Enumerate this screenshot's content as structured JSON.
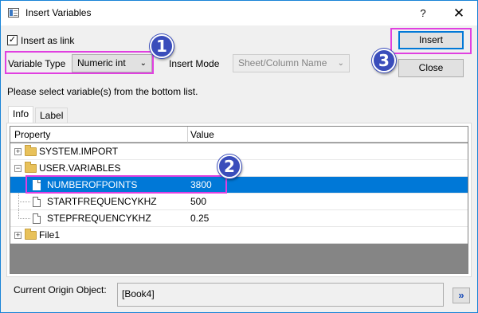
{
  "window": {
    "title": "Insert Variables",
    "help_glyph": "?",
    "close_glyph": "✕"
  },
  "options": {
    "insert_as_link_label": "Insert as link",
    "insert_as_link_checked": true,
    "check_glyph": "✓",
    "variable_type_label": "Variable Type",
    "variable_type_value": "Numeric int",
    "insert_mode_label": "Insert Mode",
    "insert_mode_value": "Sheet/Column Name"
  },
  "buttons": {
    "insert": "Insert",
    "close": "Close"
  },
  "instruction": "Please select variable(s) from the bottom list.",
  "tabs": [
    "Info",
    "Label"
  ],
  "grid": {
    "headers": [
      "Property",
      "Value"
    ],
    "rows": [
      {
        "property": "SYSTEM.IMPORT",
        "value": "",
        "type": "folder",
        "expanded": false
      },
      {
        "property": "USER.VARIABLES",
        "value": "",
        "type": "folder",
        "expanded": true
      },
      {
        "property": "NUMBEROFPOINTS",
        "value": "3800",
        "type": "item",
        "selected": true
      },
      {
        "property": "STARTFREQUENCYKHZ",
        "value": "500",
        "type": "item"
      },
      {
        "property": "STEPFREQUENCYKHZ",
        "value": "0.25",
        "type": "item"
      },
      {
        "property": "File1",
        "value": "",
        "type": "folder",
        "expanded": false
      }
    ]
  },
  "current_object": {
    "label": "Current Origin Object:",
    "value": "[Book4]",
    "nav_glyph": "»"
  },
  "callouts": [
    "1",
    "2",
    "3"
  ],
  "colors": {
    "selection": "#0078d7",
    "callout_badge": "#3a4dbb",
    "highlight_box": "#e040e0"
  }
}
